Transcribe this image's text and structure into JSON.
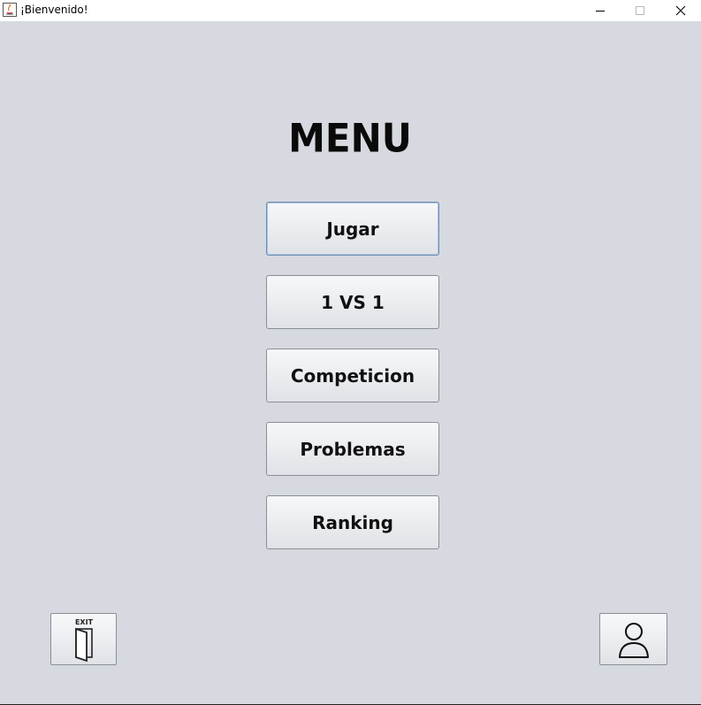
{
  "window": {
    "title": "¡Bienvenido!"
  },
  "menu": {
    "title": "MENU",
    "buttons": [
      {
        "label": "Jugar"
      },
      {
        "label": "1 VS 1"
      },
      {
        "label": "Competicion"
      },
      {
        "label": "Problemas"
      },
      {
        "label": "Ranking"
      }
    ]
  },
  "corner": {
    "exit_icon_text": "EXIT",
    "exit_icon": "exit-door-icon",
    "user_icon": "user-profile-icon"
  },
  "colors": {
    "background": "#d6d9df",
    "button_border": "#8a8e96",
    "focus_border": "#6d8fb5"
  }
}
